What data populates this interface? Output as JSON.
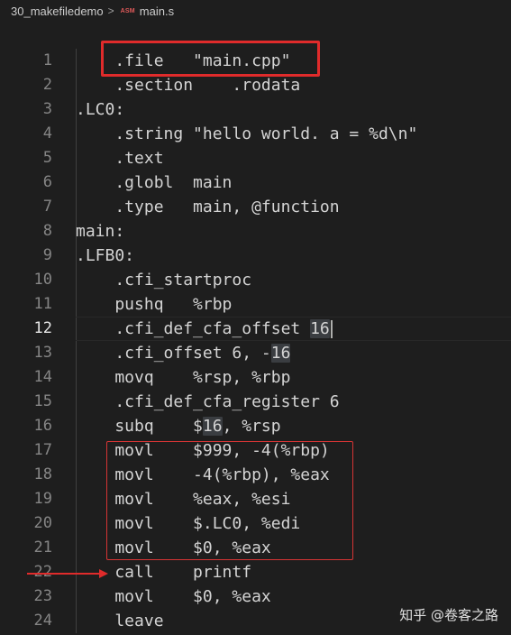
{
  "breadcrumb": {
    "folder": "30_makefiledemo",
    "separator": ">",
    "file_icon": "ASM",
    "file": "main.s"
  },
  "editor": {
    "active_line": 12,
    "lines": [
      {
        "n": "1",
        "code": "    .file   \"main.cpp\""
      },
      {
        "n": "2",
        "code": "    .section    .rodata"
      },
      {
        "n": "3",
        "code": ".LC0:"
      },
      {
        "n": "4",
        "code": "    .string \"hello world. a = %d\\n\""
      },
      {
        "n": "5",
        "code": "    .text"
      },
      {
        "n": "6",
        "code": "    .globl  main"
      },
      {
        "n": "7",
        "code": "    .type   main, @function"
      },
      {
        "n": "8",
        "code": "main:"
      },
      {
        "n": "9",
        "code": ".LFB0:"
      },
      {
        "n": "10",
        "code": "    .cfi_startproc"
      },
      {
        "n": "11",
        "code": "    pushq   %rbp"
      },
      {
        "n": "12",
        "code": "    .cfi_def_cfa_offset 16"
      },
      {
        "n": "13",
        "code": "    .cfi_offset 6, -16"
      },
      {
        "n": "14",
        "code": "    movq    %rsp, %rbp"
      },
      {
        "n": "15",
        "code": "    .cfi_def_cfa_register 6"
      },
      {
        "n": "16",
        "code": "    subq    $16, %rsp"
      },
      {
        "n": "17",
        "code": "    movl    $999, -4(%rbp)"
      },
      {
        "n": "18",
        "code": "    movl    -4(%rbp), %eax"
      },
      {
        "n": "19",
        "code": "    movl    %eax, %esi"
      },
      {
        "n": "20",
        "code": "    movl    $.LC0, %edi"
      },
      {
        "n": "21",
        "code": "    movl    $0, %eax"
      },
      {
        "n": "22",
        "code": "    call    printf"
      },
      {
        "n": "23",
        "code": "    movl    $0, %eax"
      },
      {
        "n": "24",
        "code": "    leave"
      }
    ],
    "highlight_token": "16"
  },
  "annotations": {
    "color": "#e02b2b"
  },
  "watermark": "知乎 @卷客之路"
}
